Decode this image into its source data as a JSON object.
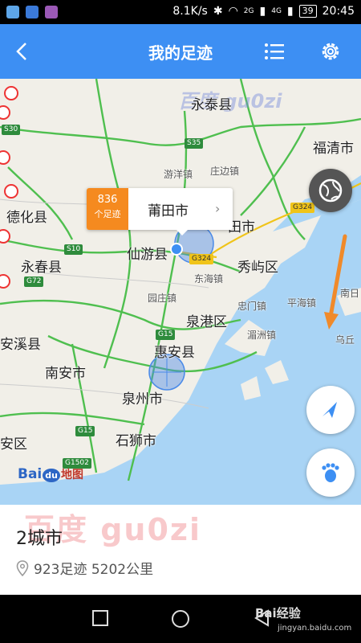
{
  "status_bar": {
    "network_speed": "8.1K/s",
    "signal_2g": "2G",
    "signal_4g": "4G",
    "battery": "39",
    "time": "20:45"
  },
  "header": {
    "title": "我的足迹",
    "back_icon": "back-arrow-icon",
    "list_icon": "list-icon",
    "settings_icon": "gear-icon",
    "color": "#3d8ff3"
  },
  "map": {
    "watermark_top": "百度 gu0zi",
    "places": [
      {
        "name": "永泰县",
        "cls": "big"
      },
      {
        "name": "福清市",
        "cls": "big"
      },
      {
        "name": "德化县",
        "cls": "big"
      },
      {
        "name": "永春县",
        "cls": "big"
      },
      {
        "name": "仙游县",
        "cls": "big"
      },
      {
        "name": "田市",
        "cls": "big"
      },
      {
        "name": "秀屿区",
        "cls": "big"
      },
      {
        "name": "泉港区",
        "cls": "big"
      },
      {
        "name": "安溪县",
        "cls": "big"
      },
      {
        "name": "惠安县",
        "cls": "big"
      },
      {
        "name": "南安市",
        "cls": "big"
      },
      {
        "name": "泉州市",
        "cls": "big"
      },
      {
        "name": "石狮市",
        "cls": "big"
      },
      {
        "name": "安区",
        "cls": "big"
      },
      {
        "name": "游洋镇",
        "cls": "small"
      },
      {
        "name": "庄边镇",
        "cls": "small"
      },
      {
        "name": "东海镇",
        "cls": "small"
      },
      {
        "name": "园庄镇",
        "cls": "small"
      },
      {
        "name": "忠门镇",
        "cls": "small"
      },
      {
        "name": "平海镇",
        "cls": "small"
      },
      {
        "name": "湄洲镇",
        "cls": "small"
      },
      {
        "name": "南日",
        "cls": "small"
      },
      {
        "name": "乌丘",
        "cls": "small"
      }
    ],
    "roads": [
      {
        "label": "S30",
        "color": "green"
      },
      {
        "label": "S35",
        "color": "green"
      },
      {
        "label": "S10",
        "color": "green"
      },
      {
        "label": "G72",
        "color": "green"
      },
      {
        "label": "G324",
        "color": "yellow"
      },
      {
        "label": "G324",
        "color": "yellow"
      },
      {
        "label": "G15",
        "color": "green"
      },
      {
        "label": "G15",
        "color": "green"
      },
      {
        "label": "G1502",
        "color": "green"
      }
    ],
    "popup": {
      "count": "836",
      "count_label": "个足迹",
      "city": "莆田市",
      "chevron": "›"
    },
    "logo": {
      "bai": "Bai",
      "du": "du",
      "map_word": "地图"
    },
    "fabs": {
      "globe_icon": "globe-icon",
      "locate_icon": "navigation-arrow-icon",
      "footprint_icon": "footprint-icon",
      "close_icon": "close-icon"
    }
  },
  "info": {
    "watermark": "百度  gu0zi",
    "cities": "2城市",
    "stats": "923足迹  5202公里",
    "location_icon": "location-pin-icon"
  },
  "nav_bar": {
    "site_mark": "Bai经验",
    "site_url": "jingyan.baidu.com"
  }
}
